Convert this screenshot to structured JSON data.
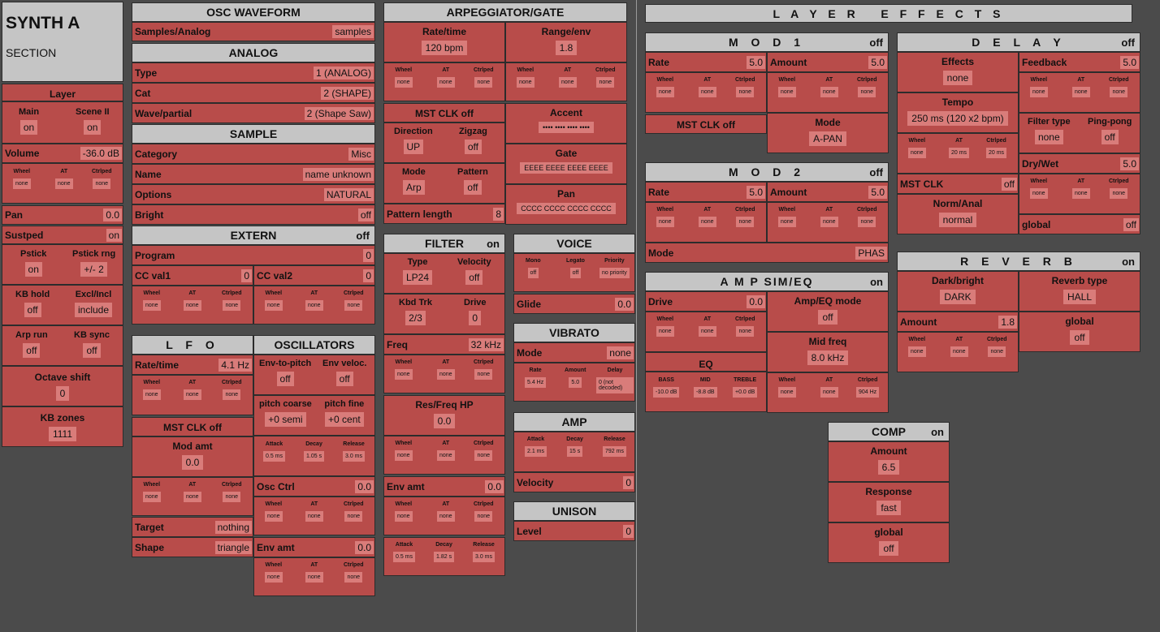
{
  "synth": {
    "title": "SYNTH A",
    "sub": "SECTION"
  },
  "layer": {
    "header": "Layer",
    "main": "Main",
    "main_v": "on",
    "scene": "Scene II",
    "scene_v": "on",
    "volume": "Volume",
    "volume_v": "-36.0 dB",
    "pan": "Pan",
    "pan_v": "0.0",
    "sustped": "Sustped",
    "sustped_v": "on",
    "pstick": "Pstick",
    "pstick_v": "on",
    "pstick_rng": "Pstick rng",
    "pstick_rng_v": "+/- 2",
    "kbhold": "KB hold",
    "kbhold_v": "off",
    "excl": "Excl/Incl",
    "excl_v": "include",
    "arprun": "Arp run",
    "arprun_v": "off",
    "kbsync": "KB sync",
    "kbsync_v": "off",
    "octave": "Octave shift",
    "octave_v": "0",
    "kbzones": "KB zones",
    "kbzones_v": "1111"
  },
  "mod": {
    "wheel": "Wheel",
    "at": "AT",
    "ctrl": "Ctrlped",
    "none": "none"
  },
  "osc": {
    "header": "OSC WAVEFORM",
    "samples": "Samples/Analog",
    "samples_v": "samples"
  },
  "analog": {
    "header": "ANALOG",
    "type": "Type",
    "type_v": "1 (ANALOG)",
    "cat": "Cat",
    "cat_v": "2 (SHAPE)",
    "wave": "Wave/partial",
    "wave_v": "2 (Shape Saw)"
  },
  "sample": {
    "header": "SAMPLE",
    "category": "Category",
    "category_v": "Misc",
    "name": "Name",
    "name_v": "name unknown",
    "options": "Options",
    "options_v": "NATURAL",
    "bright": "Bright",
    "bright_v": "off"
  },
  "extern": {
    "header": "EXTERN",
    "status": "off",
    "program": "Program",
    "program_v": "0",
    "cc1": "CC val1",
    "cc1_v": "0",
    "cc2": "CC val2",
    "cc2_v": "0"
  },
  "lfo": {
    "header": "L F O",
    "rate": "Rate/time",
    "rate_v": "4.1 Hz",
    "mst": "MST CLK off",
    "modamt": "Mod amt",
    "modamt_v": "0.0",
    "target": "Target",
    "target_v": "nothing",
    "shape": "Shape",
    "shape_v": "triangle"
  },
  "oscillators": {
    "header": "OSCILLATORS",
    "envpitch": "Env-to-pitch",
    "envpitch_v": "off",
    "envvel": "Env veloc.",
    "envvel_v": "off",
    "pcoarse": "pitch coarse",
    "pcoarse_v": "+0 semi",
    "pfine": "pitch fine",
    "pfine_v": "+0 cent",
    "attack": "Attack",
    "attack_v": "0.5 ms",
    "decay": "Decay",
    "decay_v": "1.05 s",
    "release": "Release",
    "release_v": "3.0 ms",
    "oscctrl": "Osc Ctrl",
    "oscctrl_v": "0.0",
    "envamt": "Env amt",
    "envamt_v": "0.0"
  },
  "arp": {
    "header": "ARPEGGIATOR/GATE",
    "rate": "Rate/time",
    "rate_v": "120 bpm",
    "range": "Range/env",
    "range_v": "1.8",
    "mst": "MST CLK off",
    "accent": "Accent",
    "accent_v": "•••• •••• •••• ••••",
    "direction": "Direction",
    "direction_v": "UP",
    "zigzag": "Zigzag",
    "zigzag_v": "off",
    "gate": "Gate",
    "gate_v": "EEEE EEEE EEEE EEEE",
    "mode": "Mode",
    "mode_v": "Arp",
    "pattern": "Pattern",
    "pattern_v": "off",
    "pan": "Pan",
    "pan_v": "CCCC CCCC CCCC CCCC",
    "plength": "Pattern length",
    "plength_v": "8"
  },
  "filter": {
    "header": "FILTER",
    "status": "on",
    "type": "Type",
    "type_v": "LP24",
    "velocity": "Velocity",
    "velocity_v": "off",
    "kbdtrk": "Kbd Trk",
    "kbdtrk_v": "2/3",
    "drive": "Drive",
    "drive_v": "0",
    "freq": "Freq",
    "freq_v": "32 kHz",
    "res": "Res/Freq HP",
    "res_v": "0.0",
    "envamt": "Env amt",
    "envamt_v": "0.0",
    "attack": "Attack",
    "attack_v": "0.5 ms",
    "decay": "Decay",
    "decay_v": "1.82 s",
    "release": "Release",
    "release_v": "3.0 ms"
  },
  "voice": {
    "header": "VOICE",
    "mono": "Mono",
    "mono_v": "off",
    "legato": "Legato",
    "legato_v": "off",
    "priority": "Priority",
    "priority_v": "no priority",
    "glide": "Glide",
    "glide_v": "0.0"
  },
  "vibrato": {
    "header": "VIBRATO",
    "mode": "Mode",
    "mode_v": "none",
    "rate": "Rate",
    "rate_v": "5.4 Hz",
    "amount": "Amount",
    "amount_v": "5.0",
    "delay": "Delay",
    "delay_v": "0 (not decoded)"
  },
  "amp": {
    "header": "AMP",
    "attack": "Attack",
    "attack_v": "2.1 ms",
    "decay": "Decay",
    "decay_v": "15 s",
    "release": "Release",
    "release_v": "792 ms",
    "velocity": "Velocity",
    "velocity_v": "0"
  },
  "unison": {
    "header": "UNISON",
    "level": "Level",
    "level_v": "0"
  },
  "effects": {
    "header": "L A Y E R   E F F E C T S"
  },
  "mod1": {
    "header": "M O D 1",
    "status": "off",
    "rate": "Rate",
    "rate_v": "5.0",
    "amount": "Amount",
    "amount_v": "5.0",
    "mst": "MST CLK off",
    "mode": "Mode",
    "mode_v": "A-PAN"
  },
  "mod2": {
    "header": "M O D 2",
    "status": "off",
    "rate": "Rate",
    "rate_v": "5.0",
    "amount": "Amount",
    "amount_v": "5.0",
    "mode": "Mode",
    "mode_v": "PHAS"
  },
  "ampsim": {
    "header": "A M P  SIM/EQ",
    "status": "on",
    "drive": "Drive",
    "drive_v": "0.0",
    "ampeq": "Amp/EQ mode",
    "ampeq_v": "off",
    "midfreq": "Mid freq",
    "midfreq_v": "8.0 kHz",
    "eq": "EQ",
    "bass": "BASS",
    "bass_v": "-10.0 dB",
    "mid": "MID",
    "mid_v": "-8.8 dB",
    "treble": "TREBLE",
    "treble_v": "+0.0 dB",
    "ctrl_v": "904 Hz"
  },
  "delay": {
    "header": "D E L A Y",
    "status": "off",
    "effects": "Effects",
    "effects_v": "none",
    "feedback": "Feedback",
    "feedback_v": "5.0",
    "tempo": "Tempo",
    "tempo_v": "250 ms (120 x2 bpm)",
    "ftype": "Filter type",
    "ftype_v": "none",
    "pingpong": "Ping-pong",
    "pingpong_v": "off",
    "attack_v": "20 ms",
    "ctrl_v": "20 ms",
    "drywet": "Dry/Wet",
    "drywet_v": "5.0",
    "mst": "MST CLK",
    "mst_v": "off",
    "norm": "Norm/Anal",
    "norm_v": "normal",
    "global": "global",
    "global_v": "off"
  },
  "reverb": {
    "header": "R E V E R B",
    "status": "on",
    "dark": "Dark/bright",
    "dark_v": "DARK",
    "rtype": "Reverb type",
    "rtype_v": "HALL",
    "amount": "Amount",
    "amount_v": "1.8",
    "global": "global",
    "global_v": "off"
  },
  "comp": {
    "header": "COMP",
    "status": "on",
    "amount": "Amount",
    "amount_v": "6.5",
    "response": "Response",
    "response_v": "fast",
    "global": "global",
    "global_v": "off"
  }
}
